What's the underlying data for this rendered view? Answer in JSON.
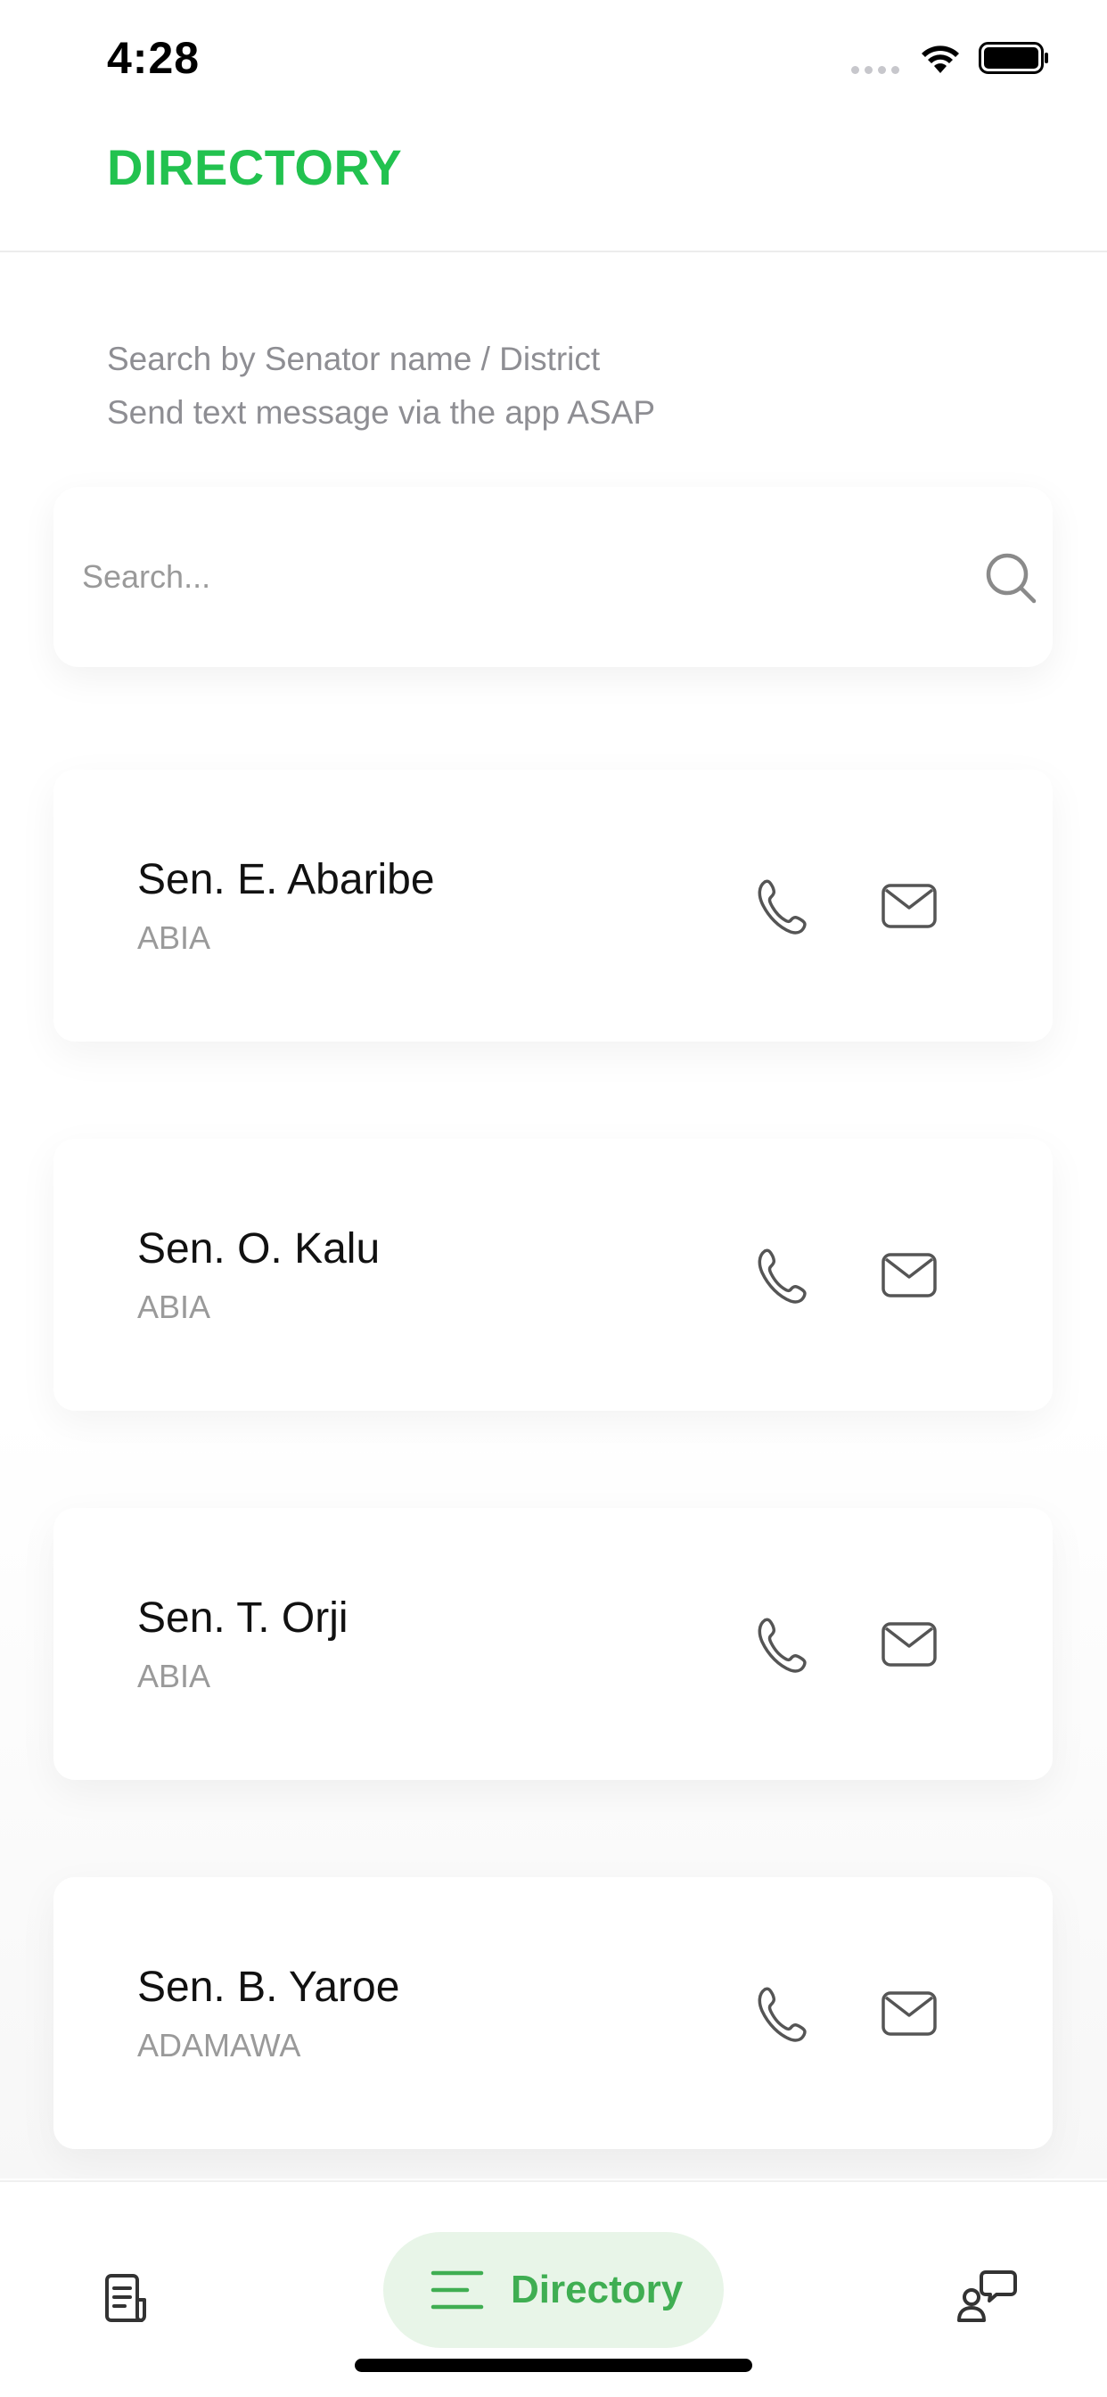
{
  "status_bar": {
    "time": "4:28",
    "wifi_icon": "wifi-icon",
    "battery_icon": "battery-icon"
  },
  "header": {
    "title": "DIRECTORY"
  },
  "instructions": {
    "line1": "Search by Senator name / District",
    "line2": "Send text message via the app ASAP"
  },
  "search": {
    "placeholder": "Search...",
    "value": "",
    "icon": "search-icon"
  },
  "senators": [
    {
      "name": "Sen. E. Abaribe",
      "district": "ABIA"
    },
    {
      "name": "Sen. O. Kalu",
      "district": "ABIA"
    },
    {
      "name": "Sen. T. Orji",
      "district": "ABIA"
    },
    {
      "name": "Sen. B. Yaroe",
      "district": "ADAMAWA"
    }
  ],
  "card_actions": {
    "call_icon": "phone-icon",
    "email_icon": "envelope-icon"
  },
  "bottom_nav": {
    "items": [
      {
        "icon": "news-icon",
        "label": ""
      },
      {
        "icon": "menu-lines-icon",
        "label": "Directory",
        "active": true
      },
      {
        "icon": "chat-user-icon",
        "label": ""
      }
    ]
  },
  "colors": {
    "accent": "#22c24f",
    "nav_active_bg": "#e8f5e8",
    "nav_active_text": "#3fae52",
    "muted_text": "#9a9a9a",
    "icon_stroke": "#555555"
  }
}
